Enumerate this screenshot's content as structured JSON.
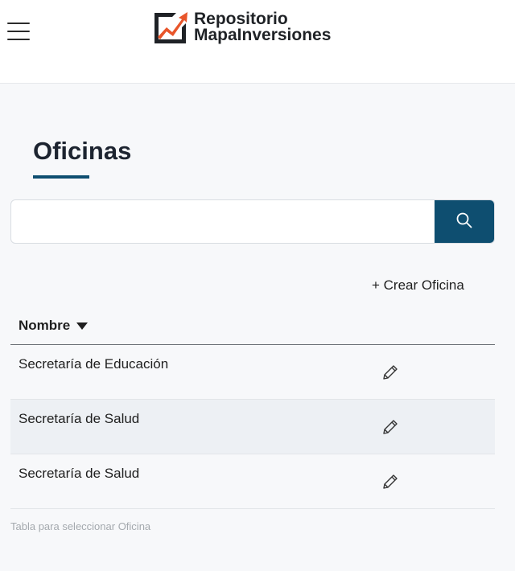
{
  "header": {
    "brand_line1": "Repositorio",
    "brand_line2": "MapaInversiones",
    "accent_colors": [
      "#e8552a",
      "#1f2226"
    ],
    "menu_icon": "hamburger-menu-icon"
  },
  "page": {
    "title": "Oficinas",
    "accent_color": "#0e4e70"
  },
  "search": {
    "value": "",
    "placeholder": "",
    "button_icon": "search-icon"
  },
  "actions": {
    "create_label": "+ Crear Oficina"
  },
  "table": {
    "columns": [
      {
        "label": "Nombre",
        "sort": "descending"
      }
    ],
    "rows": [
      {
        "name": "Secretaría de Educación",
        "action_icon": "pencil-icon"
      },
      {
        "name": "Secretaría de Salud",
        "action_icon": "pencil-icon"
      },
      {
        "name": "Secretaría de Salud",
        "action_icon": "pencil-icon"
      }
    ],
    "caption": "Tabla para seleccionar Oficina"
  }
}
